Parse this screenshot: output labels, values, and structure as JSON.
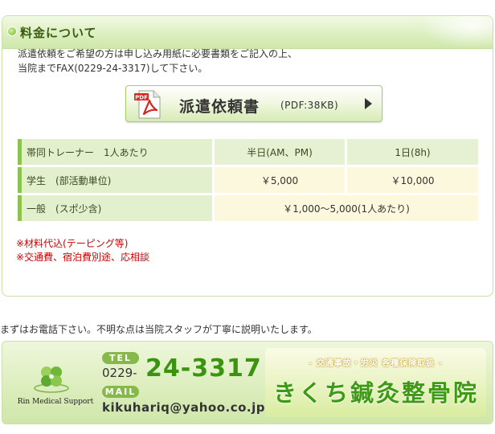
{
  "fee_section": {
    "title": "料金について",
    "intro_line1": "派遣依頼をご希望の方は申し込み用紙に必要書類をご記入の上、",
    "intro_line2": "当院までFAX(0229-24-3317)して下さい。",
    "pdf_button": {
      "icon_text": "PDF",
      "label": "派遣依頼書",
      "size": "(PDF:38KB)"
    },
    "table": {
      "header": {
        "label": "帯同トレーナー　1人あたり",
        "col1": "半日(AM、PM)",
        "col2": "1日(8h)"
      },
      "student": {
        "label": "学生　(部活動単位)",
        "col1": "￥5,000",
        "col2": "￥10,000"
      },
      "general": {
        "label": "一般　(スポ少含)",
        "value": "￥1,000～5,000(1人あたり)"
      }
    },
    "notes": [
      "※材料代込(テーピング等)",
      "※交通費、宿泊費別途、応相談"
    ]
  },
  "call_note": "まずはお電話下さい。不明な点は当院スタッフが丁寧に説明いたします。",
  "contact_banner": {
    "logo_text": "Rin Medical Support",
    "tel_label": "TEL",
    "phone_prefix": "0229-",
    "phone_main": "24-3317",
    "mail_label": "MAIL",
    "email": "kikuhariq@yahoo.co.jp",
    "clinic_subtitle": "- 交通事故・労災 各種保険取扱 -",
    "clinic_name": "きくち鍼灸整骨院"
  },
  "colors": {
    "accent_green": "#3b9410",
    "note_red": "#cc0000",
    "row_label_bg": "#e3f0cd",
    "value_bg": "#fbf8dd"
  },
  "icons": [
    "leaf-bullet-icon",
    "pdf-file-icon",
    "arrow-right-icon",
    "clover-logo-icon"
  ]
}
